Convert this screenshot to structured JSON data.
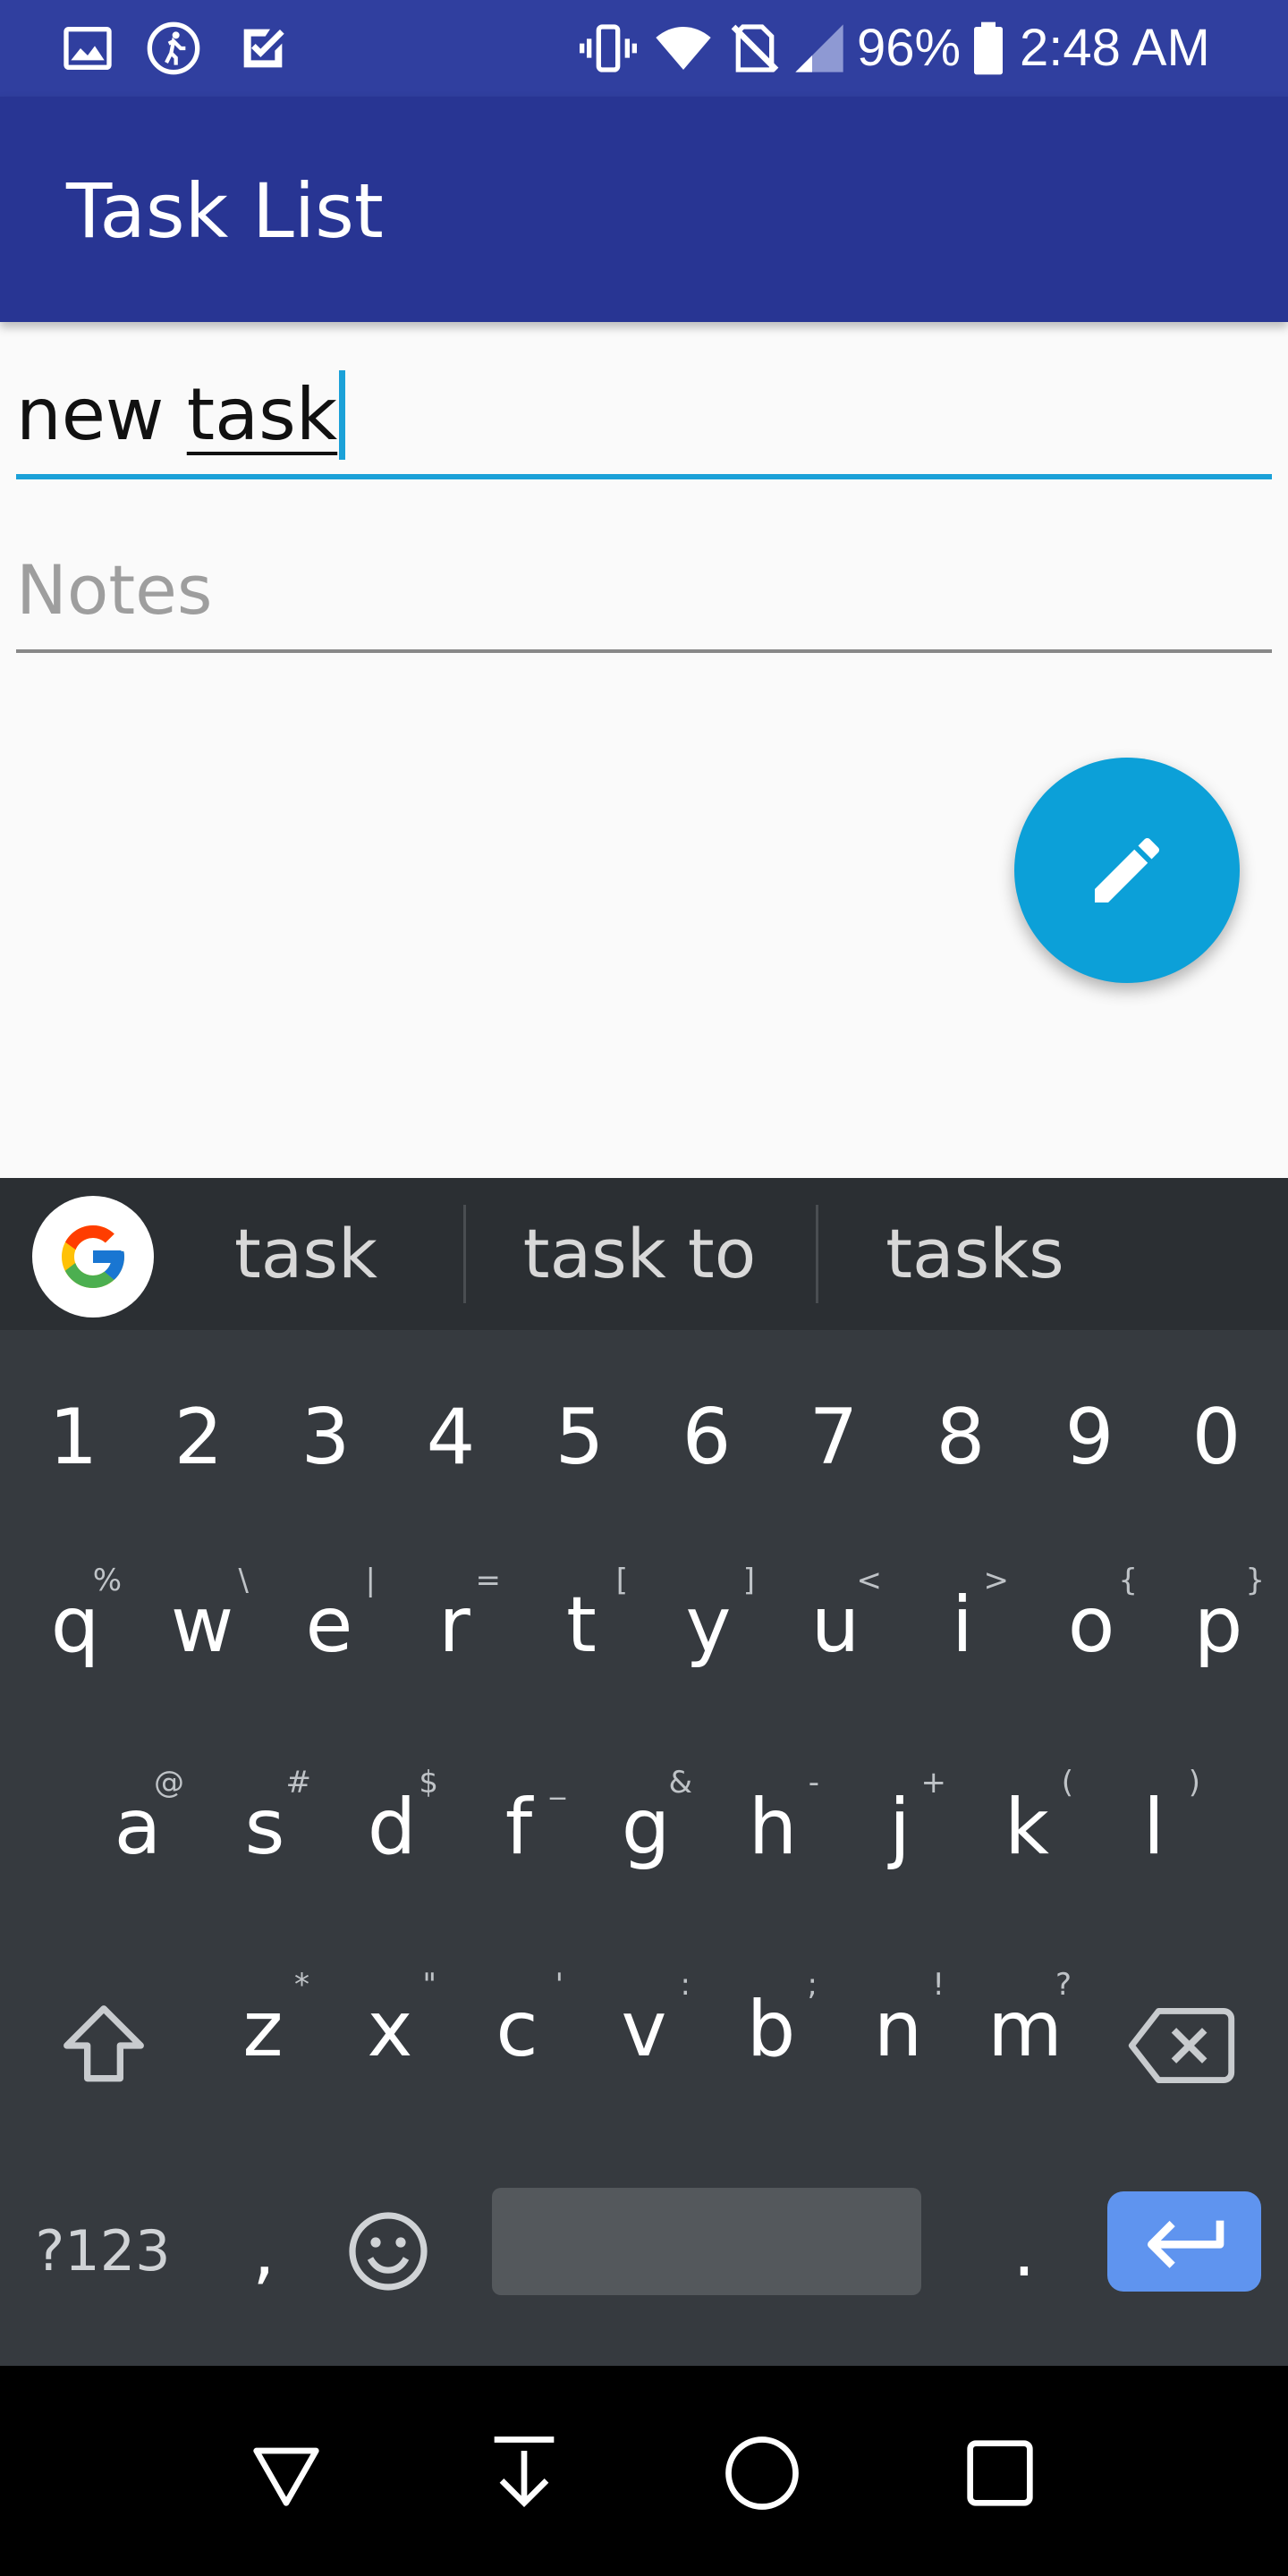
{
  "status_bar": {
    "battery": "96%",
    "time": "2:48 AM",
    "icons": [
      "image-icon",
      "running-icon",
      "task-check-icon",
      "vibrate-icon",
      "wifi-icon",
      "no-sim-icon",
      "signal-icon",
      "battery-icon"
    ]
  },
  "app_bar": {
    "title": "Task List"
  },
  "form": {
    "title_prefix": "new ",
    "title_word": "task",
    "notes_placeholder": "Notes"
  },
  "fab": {
    "icon": "pencil-icon"
  },
  "keyboard": {
    "suggestions": [
      "task",
      "task to",
      "tasks"
    ],
    "numbers": [
      "1",
      "2",
      "3",
      "4",
      "5",
      "6",
      "7",
      "8",
      "9",
      "0"
    ],
    "row1": [
      {
        "k": "q",
        "h": "%"
      },
      {
        "k": "w",
        "h": "\\"
      },
      {
        "k": "e",
        "h": "|"
      },
      {
        "k": "r",
        "h": "="
      },
      {
        "k": "t",
        "h": "["
      },
      {
        "k": "y",
        "h": "]"
      },
      {
        "k": "u",
        "h": "<"
      },
      {
        "k": "i",
        "h": ">"
      },
      {
        "k": "o",
        "h": "{"
      },
      {
        "k": "p",
        "h": "}"
      }
    ],
    "row2": [
      {
        "k": "a",
        "h": "@"
      },
      {
        "k": "s",
        "h": "#"
      },
      {
        "k": "d",
        "h": "$"
      },
      {
        "k": "f",
        "h": "_"
      },
      {
        "k": "g",
        "h": "&"
      },
      {
        "k": "h",
        "h": "-"
      },
      {
        "k": "j",
        "h": "+"
      },
      {
        "k": "k",
        "h": "("
      },
      {
        "k": "l",
        "h": ")"
      }
    ],
    "row3": [
      {
        "k": "z",
        "h": "*"
      },
      {
        "k": "x",
        "h": "\""
      },
      {
        "k": "c",
        "h": "'"
      },
      {
        "k": "v",
        "h": ":"
      },
      {
        "k": "b",
        "h": ";"
      },
      {
        "k": "n",
        "h": "!"
      },
      {
        "k": "m",
        "h": "?"
      }
    ],
    "symbols_label": "?123",
    "comma": ",",
    "period": "."
  },
  "colors": {
    "status_bar": "#303f9f",
    "app_bar": "#283593",
    "accent": "#1ba1d8",
    "keyboard_bg": "#363a3f",
    "enter_key": "#5f94ef"
  }
}
